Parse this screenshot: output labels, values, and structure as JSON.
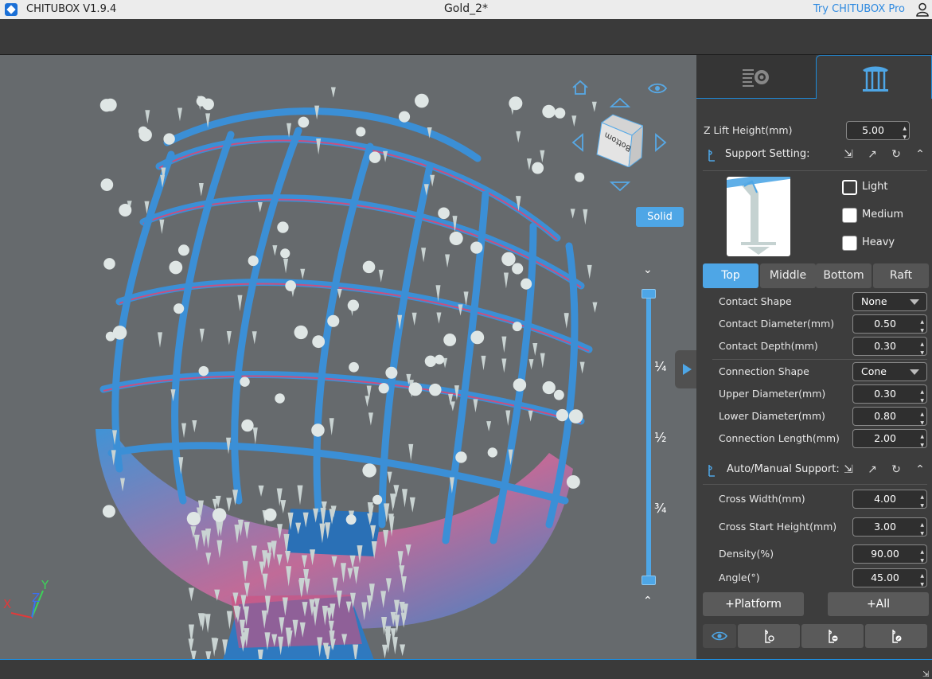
{
  "titlebar": {
    "app_name": "CHITUBOX V1.9.4",
    "document": "Gold_2*",
    "pro_link": "Try CHITUBOX Pro",
    "icons": [
      "chitubox-logo-icon",
      "user-icon"
    ]
  },
  "viewport": {
    "render_mode_button": "Solid",
    "nav_cube_face": "Bottom",
    "slider_marks": [
      "¼",
      "½",
      "¾"
    ],
    "axis_labels": {
      "x": "X",
      "y": "Y",
      "z": "Z"
    },
    "colors": {
      "model": "#3b8fd6",
      "support": "#c9d3d2",
      "background": "#666a6d",
      "accent": "#4ea6e6"
    }
  },
  "panel": {
    "tabs": [
      {
        "icon": "settings-list-icon"
      },
      {
        "icon": "supports-icon"
      }
    ],
    "z_lift": {
      "label": "Z Lift Height(mm)",
      "value": "5.00"
    },
    "support_setting": {
      "title": "Support Setting:",
      "presets": [
        {
          "label": "Light",
          "checked": true
        },
        {
          "label": "Medium",
          "checked": false
        },
        {
          "label": "Heavy",
          "checked": false
        }
      ],
      "segments": [
        "Top",
        "Middle",
        "Bottom",
        "Raft"
      ],
      "active_segment": "Top",
      "fields": {
        "contact_shape": {
          "label": "Contact Shape",
          "value": "None"
        },
        "contact_diameter": {
          "label": "Contact Diameter(mm)",
          "value": "0.50"
        },
        "contact_depth": {
          "label": "Contact Depth(mm)",
          "value": "0.30"
        },
        "connection_shape": {
          "label": "Connection Shape",
          "value": "Cone"
        },
        "upper_diameter": {
          "label": "Upper Diameter(mm)",
          "value": "0.30"
        },
        "lower_diameter": {
          "label": "Lower Diameter(mm)",
          "value": "0.80"
        },
        "connection_length": {
          "label": "Connection Length(mm)",
          "value": "2.00"
        }
      }
    },
    "auto_manual": {
      "title": "Auto/Manual Support:",
      "fields": {
        "cross_width": {
          "label": "Cross Width(mm)",
          "value": "4.00"
        },
        "cross_start_height": {
          "label": "Cross Start Height(mm)",
          "value": "3.00"
        },
        "density": {
          "label": "Density(%)",
          "value": "90.00"
        },
        "angle": {
          "label": "Angle(°)",
          "value": "45.00"
        }
      }
    },
    "buttons": {
      "platform": "+Platform",
      "all": "+All"
    }
  }
}
